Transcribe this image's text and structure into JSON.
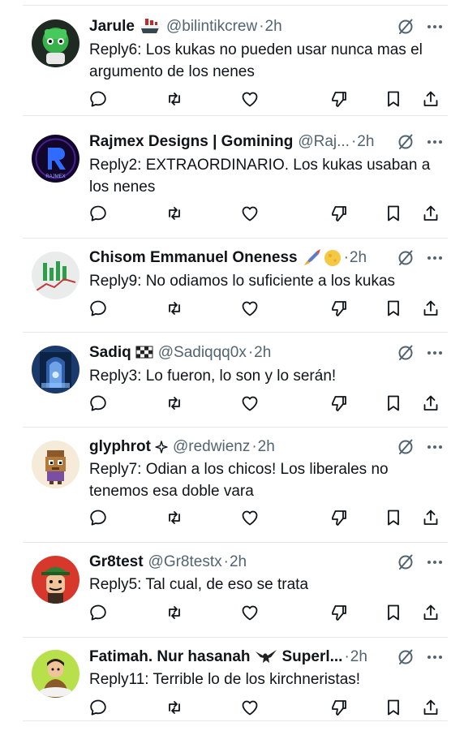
{
  "replies": [
    {
      "name": "Jarule",
      "handle": "@bilintikcrew",
      "time": "2h",
      "text": "Reply6: Los kukas no pueden usar nunca mas el argumento de los nenes",
      "avatar_bg": "#1f2a22",
      "emoji_icon": "ship-icon"
    },
    {
      "name": "Rajmex Designs | Gomining",
      "handle": "@Raj...",
      "time": "2h",
      "text": "Reply2: EXTRAORDINARIO. Los kukas usaban a los nenes",
      "avatar_bg": "#12072b"
    },
    {
      "name": "Chisom Emmanuel Oneness",
      "handle": "",
      "time": "2h",
      "text": "Reply9: No odiamos lo suficiente a los kukas",
      "avatar_bg": "#e9eceb",
      "emoji_icon": "rocket-moon-icon"
    },
    {
      "name": "Sadiq",
      "handle": "@Sadiqqq0x",
      "time": "2h",
      "text": "Reply3: Lo fueron, lo son y lo serán!",
      "avatar_bg": "#1a3a6b",
      "emoji_icon": "checkered-flag-icon"
    },
    {
      "name": "glyphrot",
      "handle": "@redwienz",
      "time": "2h",
      "text": "Reply7: Odian a los chicos! Los liberales no tenemos esa doble vara",
      "avatar_bg": "#f6ead8",
      "emoji_icon": "sparkle-icon"
    },
    {
      "name": "Gr8test",
      "handle": "@Gr8testx",
      "time": "2h",
      "text": "Reply5: Tal cual, de eso se trata",
      "avatar_bg": "#d8382c"
    },
    {
      "name": "Fatimah. Nur hasanah",
      "handle": "Superl...",
      "time": "2h",
      "text": "Reply11: Terrible lo de los kirchneristas!",
      "avatar_bg": "#b8e04a",
      "emoji_icon": "eagle-icon"
    }
  ],
  "separator": "·",
  "icons": {
    "reply": "reply-icon",
    "repost": "repost-icon",
    "like": "like-icon",
    "dislike": "dislike-icon",
    "bookmark": "bookmark-icon",
    "share": "share-icon",
    "grok": "grok-icon",
    "more": "more-icon"
  },
  "colors": {
    "text": "#0f1419",
    "muted": "#536471",
    "divider": "#e6e9ec"
  }
}
